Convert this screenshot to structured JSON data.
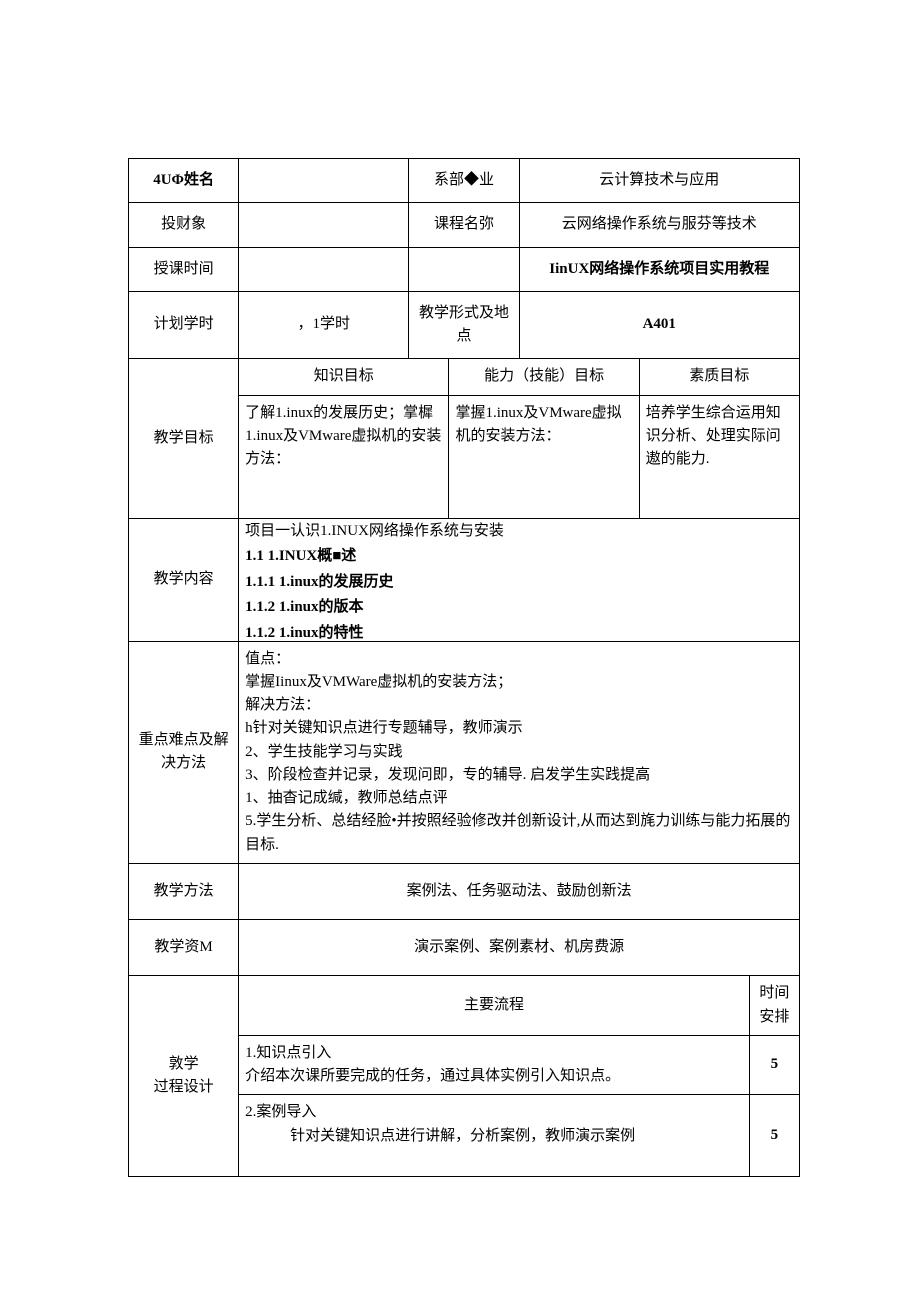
{
  "row1": {
    "label": "4UΦ姓名",
    "v1": "",
    "mid": "系部◆业",
    "v2": "云计算技术与应用"
  },
  "row2": {
    "label": "投财象",
    "v1": "",
    "mid": "课程名弥",
    "v2": "云网络操作系统与服芬等技术"
  },
  "row3": {
    "label": "授课时间",
    "v1": "",
    "mid": "",
    "v2": "IinUX网络操作系统项目实用教程"
  },
  "row4": {
    "label": "计划学时",
    "v1": "，1学时",
    "mid": "教学形式及地点",
    "v2": "A401"
  },
  "goals": {
    "label": "教学目标",
    "h1": "知识目标",
    "h2": "能力（技能）目标",
    "h3": "素质目标",
    "c1": "了解1.inux的发展历史；掌樨1.inux及VMware虚拟机的安装方法：",
    "c2": "掌握1.inux及VMware虚拟机的安装方法：",
    "c3": "培养学生综合运用知识分析、处理实际问遨的能力."
  },
  "content": {
    "label": "教学内容",
    "lines": [
      "项目一认识1.INUX网络操作系统与安装",
      "1.1 1.INUX概■述",
      "1.1.1 1.inux的发展历史",
      "1.1.2 1.inux的版本",
      "1.1.2 1.inux的特性"
    ]
  },
  "difficulty": {
    "label": "重点难点及解决方法",
    "text": "值点：\n掌握Iinux及VMWare虚拟机的安装方法；\n解决方法：\nh针对关键知识点进行专题辅导，教师演示\n2、学生技能学习与实践\n3、阶段检查并记录，发现问即，专的辅导. 启发学生实践提高\n1、抽杳记成缄，教师总结点评\n5.学生分析、总结经脸•并按照经验修改并创新设计,从而达到旄力训练与能力拓展的目标."
  },
  "method": {
    "label": "教学方法",
    "val": "案例法、任务驱动法、鼓励创新法"
  },
  "resource": {
    "label": "教学资M",
    "val": "演示案例、案例素材、机房费源"
  },
  "process": {
    "label": "敦学\n过程设计",
    "h1": "主要流程",
    "h2": "时间安排",
    "r1": {
      "text": "1.知识点引入\n介绍本次课所要完成的任务，通过具体实例引入知识点。",
      "t": "5"
    },
    "r2": {
      "text": "2.案例导入\n　　　针对关键知识点进行讲解，分析案例，教师演示案例",
      "t": "5"
    }
  }
}
